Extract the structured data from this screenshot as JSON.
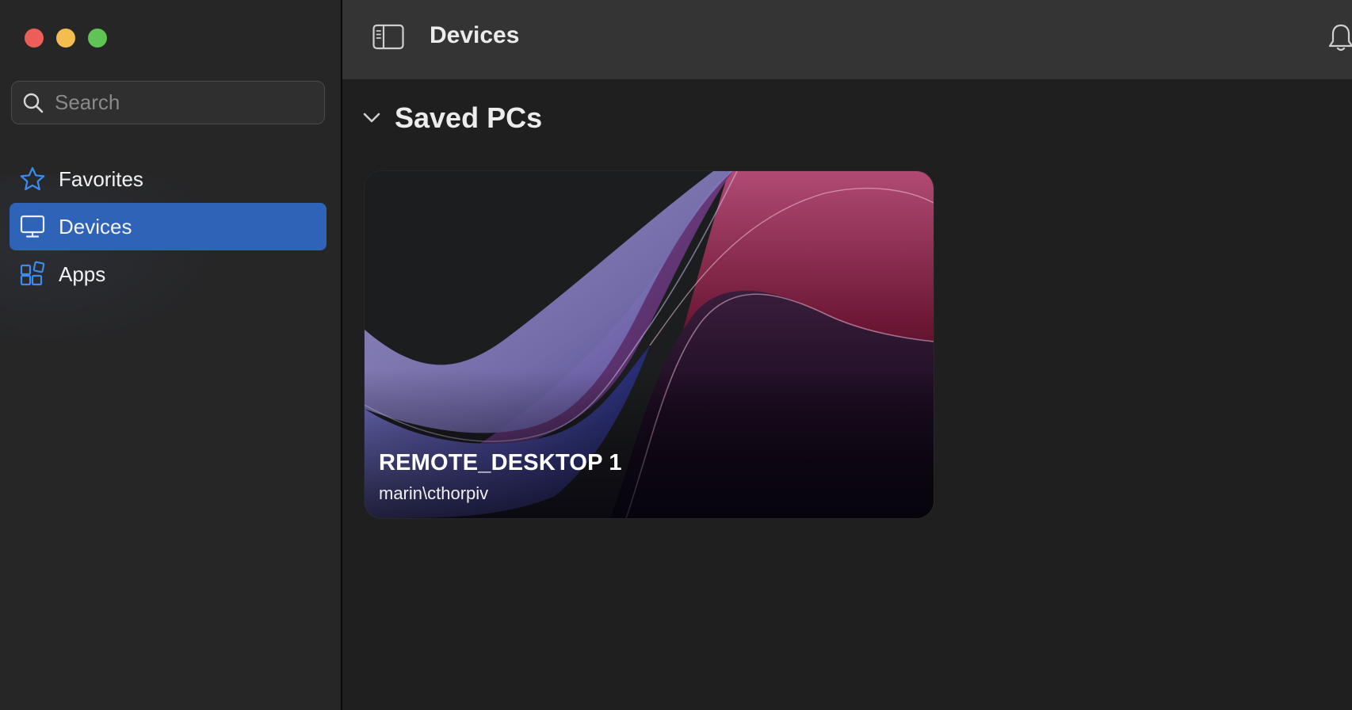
{
  "sidebar": {
    "search": {
      "placeholder": "Search",
      "value": ""
    },
    "items": [
      {
        "label": "Favorites",
        "icon": "star-icon",
        "selected": false
      },
      {
        "label": "Devices",
        "icon": "monitor-icon",
        "selected": true
      },
      {
        "label": "Apps",
        "icon": "apps-grid-icon",
        "selected": false
      }
    ]
  },
  "toolbar": {
    "title": "Devices",
    "toggle_icon": "sidebar-toggle-icon",
    "notifications_icon": "bell-icon"
  },
  "main": {
    "section": {
      "title": "Saved PCs",
      "expanded": true
    },
    "pcs": [
      {
        "name": "REMOTE_DESKTOP 1",
        "user": "marin\\cthorpiv"
      }
    ]
  },
  "colors": {
    "accent": "#2f63b8",
    "accent_icon": "#3d8cf0",
    "close": "#ec5f59",
    "minimize": "#f4bd4f",
    "maximize": "#5fc453",
    "sidebar_bg": "#262627",
    "toolbar_bg": "#343435",
    "content_bg": "#1f1f1f"
  }
}
